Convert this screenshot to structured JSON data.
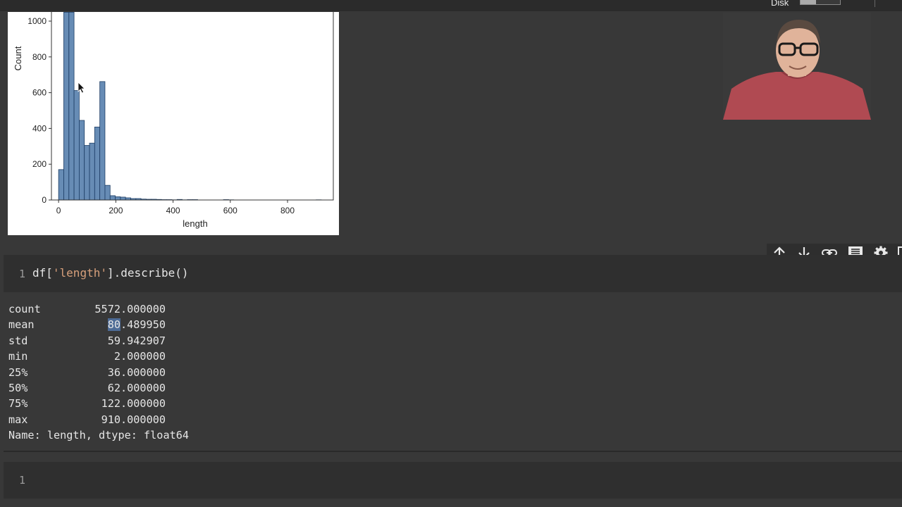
{
  "topbar": {
    "disk_label": "Disk",
    "disk_usage_fraction": 0.4
  },
  "histogram": {
    "ylabel": "Count",
    "xlabel": "length",
    "y_ticks": [
      "0",
      "200",
      "400",
      "600",
      "800",
      "1000"
    ],
    "x_ticks": [
      "0",
      "200",
      "400",
      "600",
      "800"
    ],
    "bar_color": "#4c78a8"
  },
  "chart_data": {
    "type": "bar",
    "xlabel": "length",
    "ylabel": "Count",
    "xlim": [
      -25,
      960
    ],
    "ylim": [
      0,
      1000
    ],
    "bin_width": 18,
    "bins": [
      {
        "x": 0,
        "count": 170
      },
      {
        "x": 18,
        "count": 1050
      },
      {
        "x": 36,
        "count": 1050
      },
      {
        "x": 54,
        "count": 612
      },
      {
        "x": 72,
        "count": 445
      },
      {
        "x": 90,
        "count": 305
      },
      {
        "x": 108,
        "count": 318
      },
      {
        "x": 126,
        "count": 408
      },
      {
        "x": 144,
        "count": 662
      },
      {
        "x": 162,
        "count": 82
      },
      {
        "x": 180,
        "count": 24
      },
      {
        "x": 198,
        "count": 18
      },
      {
        "x": 216,
        "count": 16
      },
      {
        "x": 234,
        "count": 12
      },
      {
        "x": 252,
        "count": 8
      },
      {
        "x": 270,
        "count": 8
      },
      {
        "x": 288,
        "count": 5
      },
      {
        "x": 306,
        "count": 4
      },
      {
        "x": 324,
        "count": 4
      },
      {
        "x": 342,
        "count": 3
      },
      {
        "x": 360,
        "count": 2
      },
      {
        "x": 378,
        "count": 2
      },
      {
        "x": 396,
        "count": 1
      },
      {
        "x": 414,
        "count": 3
      },
      {
        "x": 432,
        "count": 1
      },
      {
        "x": 450,
        "count": 2
      },
      {
        "x": 468,
        "count": 2
      },
      {
        "x": 576,
        "count": 2
      },
      {
        "x": 594,
        "count": 1
      },
      {
        "x": 900,
        "count": 1
      }
    ]
  },
  "cell_toolbar": {
    "icons": [
      "move-up-icon",
      "move-down-icon",
      "link-icon",
      "comment-icon",
      "settings-icon"
    ]
  },
  "code_cell": {
    "line_number": "1",
    "code_prefix": "df[",
    "code_string": "'length'",
    "code_suffix": "].describe()"
  },
  "describe_output": {
    "rows": [
      {
        "key": "count",
        "value": "5572.000000"
      },
      {
        "key": "mean",
        "value_selected": "80",
        "value_rest": ".489950"
      },
      {
        "key": "std",
        "value": "59.942907"
      },
      {
        "key": "min",
        "value": "2.000000"
      },
      {
        "key": "25%",
        "value": "36.000000"
      },
      {
        "key": "50%",
        "value": "62.000000"
      },
      {
        "key": "75%",
        "value": "122.000000"
      },
      {
        "key": "max",
        "value": "910.000000"
      }
    ],
    "footer": "Name: length, dtype: float64"
  },
  "empty_cell": {
    "line_number": "1"
  }
}
